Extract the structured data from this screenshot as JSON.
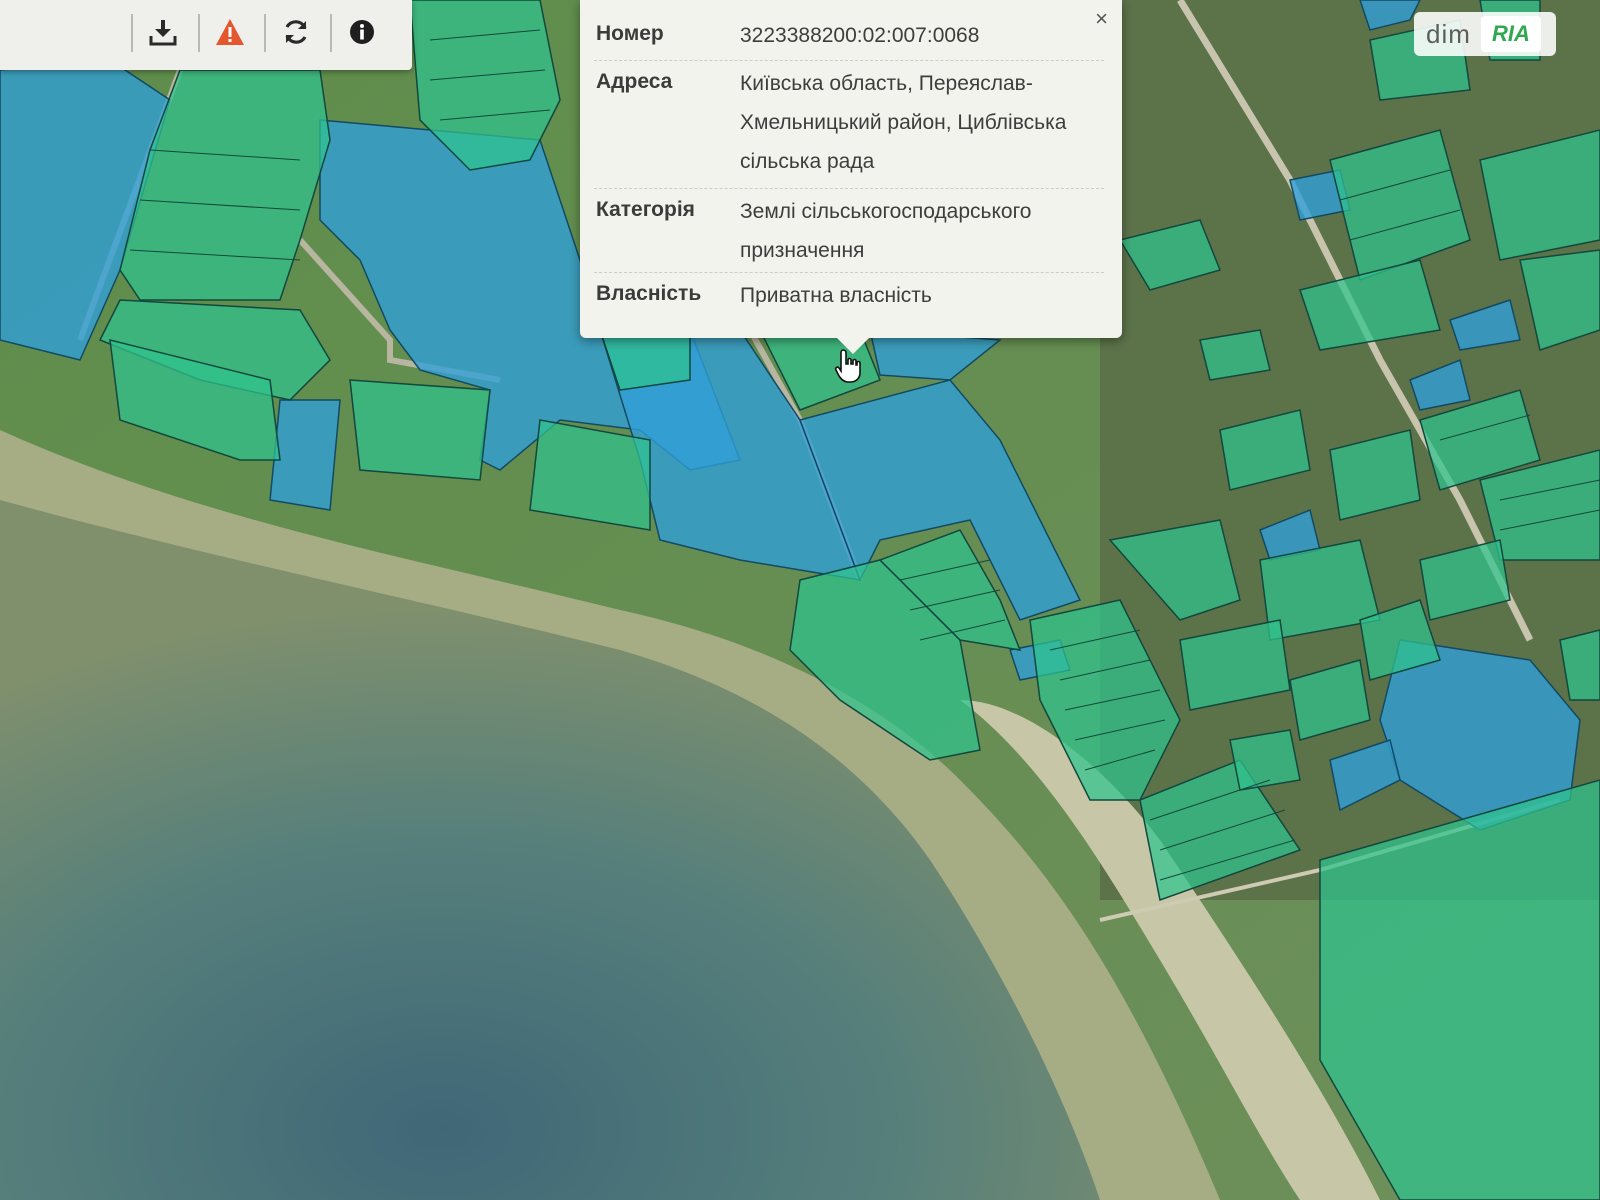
{
  "toolbar": {
    "icons": [
      "download-icon",
      "warning-icon",
      "refresh-icon",
      "info-icon"
    ],
    "warning_color": "#e4572e"
  },
  "popup": {
    "close_label": "×",
    "fields": [
      {
        "label": "Номер",
        "value": "3223388200:02:007:0068"
      },
      {
        "label": "Адреса",
        "value": "Київська область, Переяслав-Хмельницький район, Циблівська сільська рада"
      },
      {
        "label": "Категорія",
        "value": "Землі сільськогосподарського призначення"
      },
      {
        "label": "Власність",
        "value": "Приватна власність"
      }
    ]
  },
  "watermark": {
    "left": "dim",
    "right": "RIA"
  },
  "map": {
    "parcel_colors": {
      "agricultural": "#2fc38e",
      "other": "#2f9fd8",
      "border": "#13493f"
    }
  }
}
